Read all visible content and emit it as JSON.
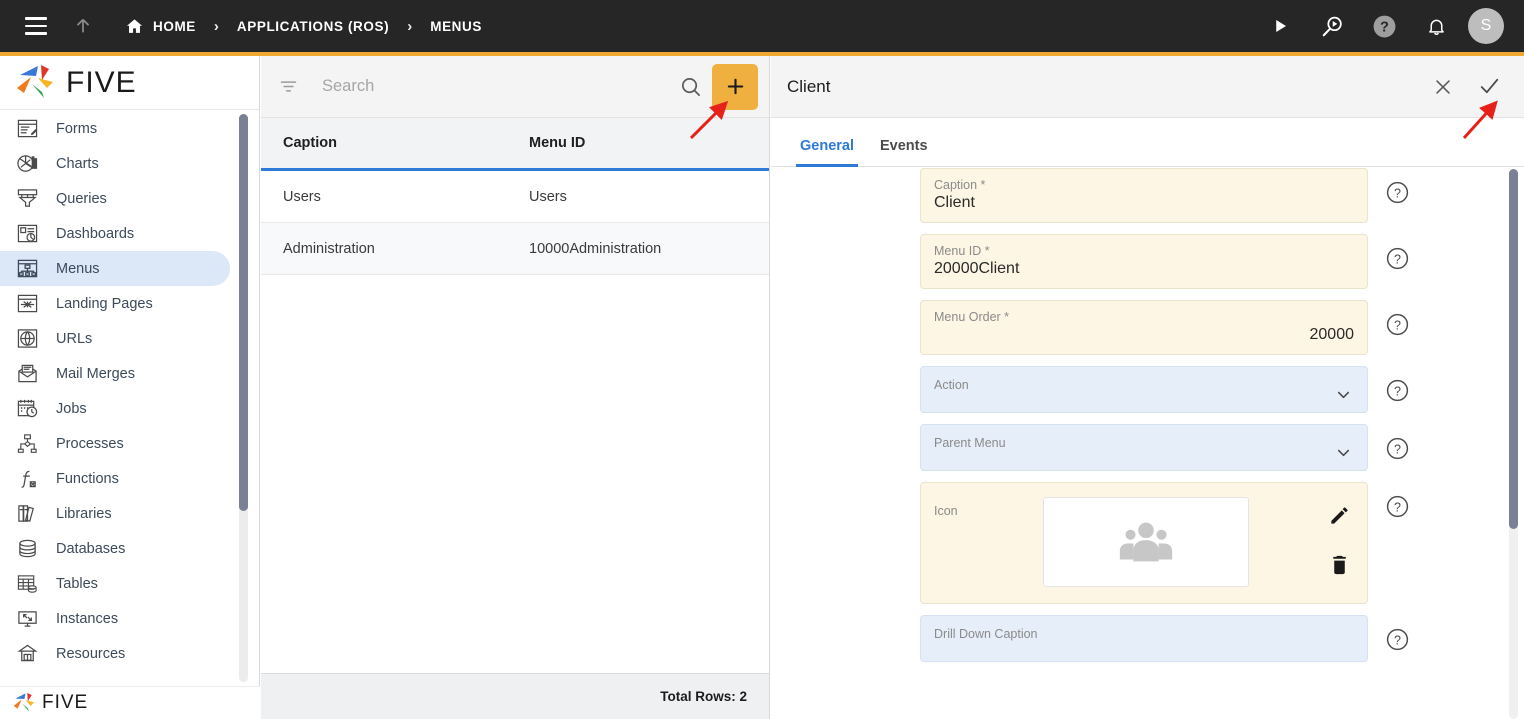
{
  "topbar": {
    "menu_icon": "hamburger-icon",
    "up_icon": "arrow-up-icon",
    "home_icon": "home-icon",
    "breadcrumb": [
      {
        "label": "HOME"
      },
      {
        "label": "APPLICATIONS (ROS)"
      },
      {
        "label": "MENUS"
      }
    ],
    "separator": "›",
    "actions": [
      {
        "name": "run-button",
        "icon": "play-icon"
      },
      {
        "name": "debug-button",
        "icon": "magnify-play-icon"
      },
      {
        "name": "help-button",
        "icon": "question-circle-icon"
      },
      {
        "name": "notifications-button",
        "icon": "bell-icon"
      }
    ],
    "avatar_initial": "S",
    "accent_color": "#f0a830",
    "background_color": "#262626"
  },
  "sidebar": {
    "brand": "FIVE",
    "brand_footer": "FIVE",
    "items": [
      {
        "label": "Forms",
        "icon": "forms-icon",
        "active": false
      },
      {
        "label": "Charts",
        "icon": "charts-icon",
        "active": false
      },
      {
        "label": "Queries",
        "icon": "queries-icon",
        "active": false
      },
      {
        "label": "Dashboards",
        "icon": "dashboards-icon",
        "active": false
      },
      {
        "label": "Menus",
        "icon": "menus-icon",
        "active": true
      },
      {
        "label": "Landing Pages",
        "icon": "landing-pages-icon",
        "active": false
      },
      {
        "label": "URLs",
        "icon": "urls-icon",
        "active": false
      },
      {
        "label": "Mail Merges",
        "icon": "mail-merges-icon",
        "active": false
      },
      {
        "label": "Jobs",
        "icon": "jobs-icon",
        "active": false
      },
      {
        "label": "Processes",
        "icon": "processes-icon",
        "active": false
      },
      {
        "label": "Functions",
        "icon": "functions-icon",
        "active": false
      },
      {
        "label": "Libraries",
        "icon": "libraries-icon",
        "active": false
      },
      {
        "label": "Databases",
        "icon": "databases-icon",
        "active": false
      },
      {
        "label": "Tables",
        "icon": "tables-icon",
        "active": false
      },
      {
        "label": "Instances",
        "icon": "instances-icon",
        "active": false
      },
      {
        "label": "Resources",
        "icon": "resources-icon",
        "active": false
      }
    ],
    "active_color": "#dce8f8"
  },
  "list_panel": {
    "search": {
      "value": "",
      "placeholder": "Search"
    },
    "filter_icon": "filter-icon",
    "search_icon": "search-icon",
    "add_button": {
      "icon": "plus-icon",
      "color": "#f0b040"
    },
    "columns": [
      "Caption",
      "Menu ID"
    ],
    "rows": [
      {
        "caption": "Users",
        "menu_id": "Users"
      },
      {
        "caption": "Administration",
        "menu_id": "10000Administration"
      }
    ],
    "footer": "Total Rows: 2",
    "header_underline_color": "#2d7ad9"
  },
  "detail": {
    "title": "Client",
    "close_icon": "close-icon",
    "confirm_icon": "check-icon",
    "tabs": [
      {
        "label": "General",
        "active": true
      },
      {
        "label": "Events",
        "active": false
      }
    ],
    "fields": [
      {
        "label": "Caption *",
        "value": "Client",
        "style": "beige",
        "kind": "text",
        "align": "left"
      },
      {
        "label": "Menu ID *",
        "value": "20000Client",
        "style": "beige",
        "kind": "text",
        "align": "left"
      },
      {
        "label": "Menu Order *",
        "value": "20000",
        "style": "beige",
        "kind": "text",
        "align": "right"
      },
      {
        "label": "Action",
        "value": "",
        "style": "blue",
        "kind": "select",
        "align": "left"
      },
      {
        "label": "Parent Menu",
        "value": "",
        "style": "blue",
        "kind": "select",
        "align": "left"
      },
      {
        "label": "Icon",
        "value": "",
        "style": "beige",
        "kind": "image",
        "align": "left"
      },
      {
        "label": "Drill Down Caption",
        "value": "",
        "style": "blue",
        "kind": "text",
        "align": "left"
      }
    ],
    "icon_field": {
      "preview_icon": "people-group-icon",
      "edit_icon": "pencil-icon",
      "delete_icon": "trash-icon"
    },
    "help_icon": "question-circle-outline-icon",
    "accent_color": "#2d7ad9"
  },
  "annotations": [
    {
      "name": "arrow-to-add-button",
      "color": "#e8201a"
    },
    {
      "name": "arrow-to-confirm-button",
      "color": "#e8201a"
    }
  ]
}
